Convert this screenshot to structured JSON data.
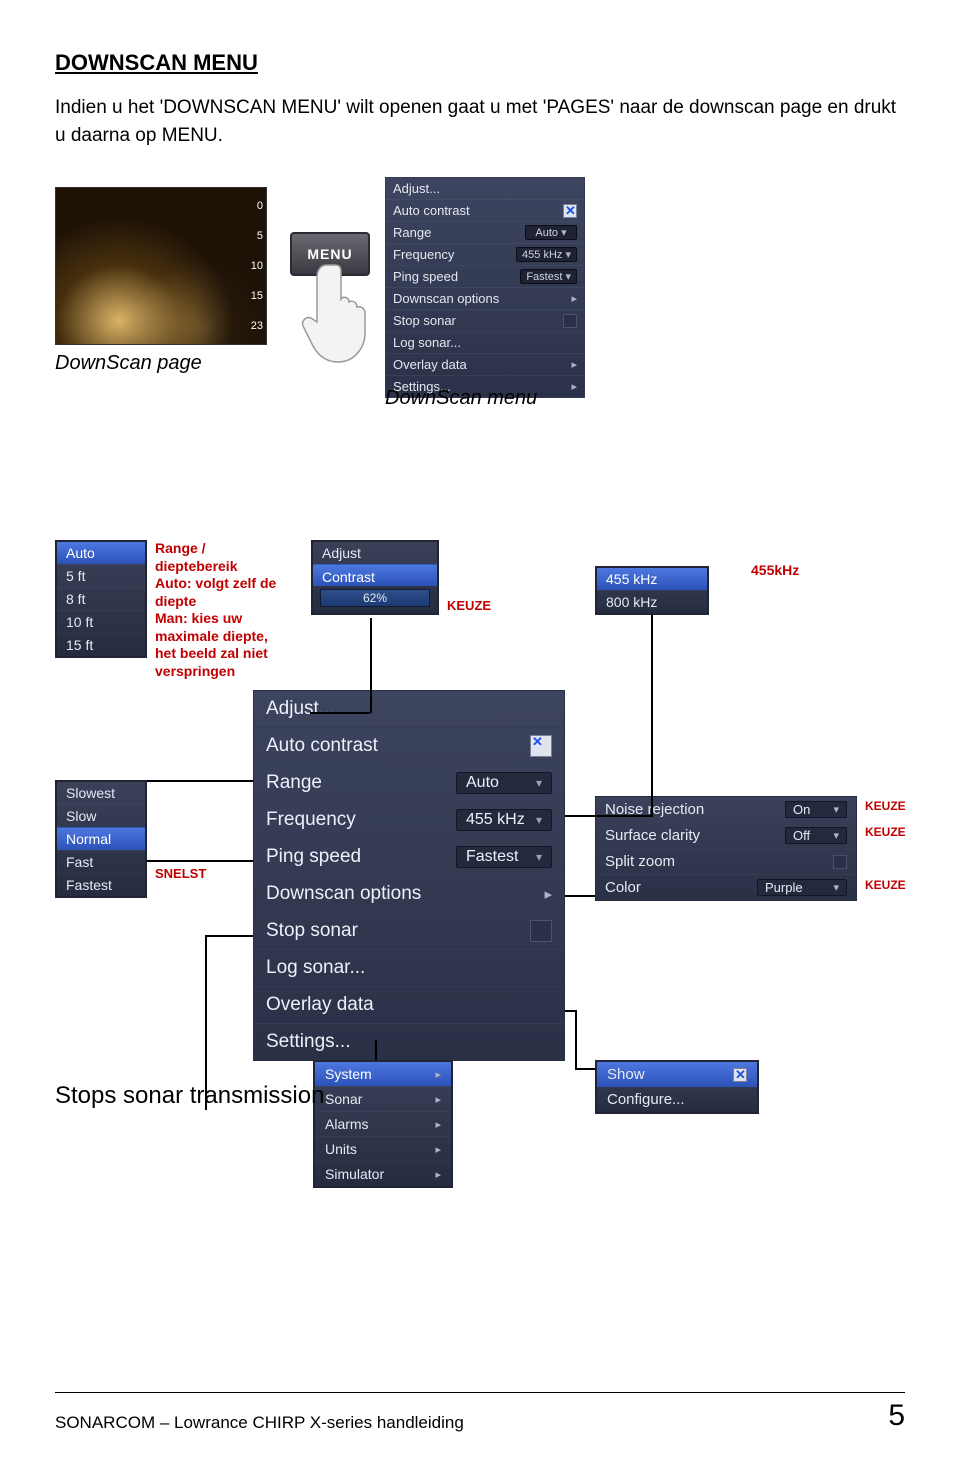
{
  "title": "DOWNSCAN MENU",
  "intro": "Indien u het 'DOWNSCAN MENU' wilt openen gaat u met 'PAGES' naar de downscan page en drukt u daarna op  MENU.",
  "downscan_page_label": "DownScan page",
  "menu_button": "MENU",
  "scale": [
    "0",
    "5",
    "10",
    "15",
    "23"
  ],
  "small_menu": {
    "adjust": "Adjust...",
    "auto_contrast": "Auto contrast",
    "range_label": "Range",
    "range_val": "Auto",
    "freq_label": "Frequency",
    "freq_val": "455 kHz",
    "ping_label": "Ping speed",
    "ping_val": "Fastest",
    "down_opts": "Downscan options",
    "stop": "Stop sonar",
    "log": "Log sonar...",
    "overlay": "Overlay data",
    "settings": "Settings..."
  },
  "downscan_menu_label": "DownScan menu",
  "range_list": [
    "Auto",
    "5 ft",
    "8 ft",
    "10 ft",
    "15 ft"
  ],
  "range_text": {
    "title": "Range / dieptebereik",
    "line1": "Auto: volgt zelf de diepte",
    "line2": "Man: kies uw maximale diepte, het beeld zal niet verspringen"
  },
  "adjust_box": {
    "adjust": "Adjust",
    "contrast": "Contrast",
    "value": "62%",
    "keuze": "KEUZE"
  },
  "freq_list": [
    "455 kHz",
    "800 kHz"
  ],
  "freq_label": "455kHz",
  "big_menu": {
    "adjust": "Adjust...",
    "auto_contrast": "Auto contrast",
    "range_label": "Range",
    "range_val": "Auto",
    "freq_label": "Frequency",
    "freq_val": "455 kHz",
    "ping_label": "Ping speed",
    "ping_val": "Fastest",
    "down_opts": "Downscan options",
    "stop": "Stop sonar",
    "log": "Log sonar...",
    "overlay": "Overlay data",
    "settings": "Settings..."
  },
  "speed_list": [
    "Slowest",
    "Slow",
    "Normal",
    "Fast",
    "Fastest"
  ],
  "snelst": "SNELST",
  "opts_menu": {
    "noise_label": "Noise rejection",
    "noise_val": "On",
    "surface_label": "Surface clarity",
    "surface_val": "Off",
    "split": "Split zoom",
    "color_label": "Color",
    "color_val": "Purple",
    "keuze": "KEUZE"
  },
  "settings_list": [
    "System",
    "Sonar",
    "Alarms",
    "Units",
    "Simulator"
  ],
  "show_box": {
    "show": "Show",
    "configure": "Configure..."
  },
  "stops": "Stops sonar transmission",
  "footer": {
    "text": "SONARCOM – Lowrance CHIRP X-series handleiding",
    "page": "5"
  }
}
